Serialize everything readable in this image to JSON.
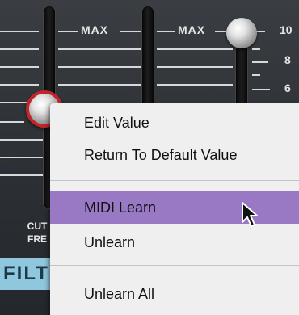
{
  "panel": {
    "max_labels": [
      "MAX",
      "MAX"
    ],
    "scale_numbers": [
      "10",
      "8",
      "6"
    ],
    "cutoff_label_line1": "CUT",
    "cutoff_label_line2": "FRE",
    "section_label": "FILT"
  },
  "context_menu": {
    "items": [
      {
        "label": "Edit Value",
        "highlighted": false
      },
      {
        "label": "Return To Default Value",
        "highlighted": false
      },
      {
        "label": "MIDI Learn",
        "highlighted": true
      },
      {
        "label": "Unlearn",
        "highlighted": false
      },
      {
        "label": "Unlearn All",
        "highlighted": false
      }
    ],
    "highlight_color": "#9a79c4"
  }
}
